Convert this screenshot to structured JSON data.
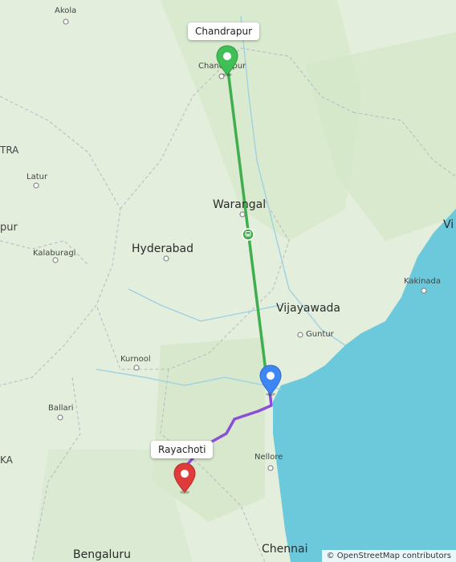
{
  "map": {
    "labels": {
      "akola": "Akola",
      "tra": "TRA",
      "latur": "Latur",
      "pur": "pur",
      "kalaburagi": "Kalaburagi",
      "hyderabad": "Hyderabad",
      "warangal": "Warangal",
      "chandrapur_town": "Chandrapur",
      "vi": "Vi",
      "kakinada": "Kakinada",
      "vijayawada": "Vijayawada",
      "guntur": "Guntur",
      "kurnool": "Kurnool",
      "ballari": "Ballari",
      "ka": "KA",
      "nellore": "Nellore",
      "bengaluru": "Bengaluru",
      "chennai": "Chennai"
    },
    "callouts": {
      "origin": "Chandrapur",
      "destination": "Rayachoti"
    },
    "attribution": "© OpenStreetMap contributors",
    "colors": {
      "land": "#e3eedc",
      "sea": "#6cc9dc",
      "route_train": "#3fae4f",
      "route_drive": "#8a4fd6",
      "pin_origin": "#3fbf56",
      "pin_mid": "#3d86f3",
      "pin_destination": "#e03b3b"
    },
    "icons": [
      "train-icon",
      "map-pin-icon"
    ]
  }
}
